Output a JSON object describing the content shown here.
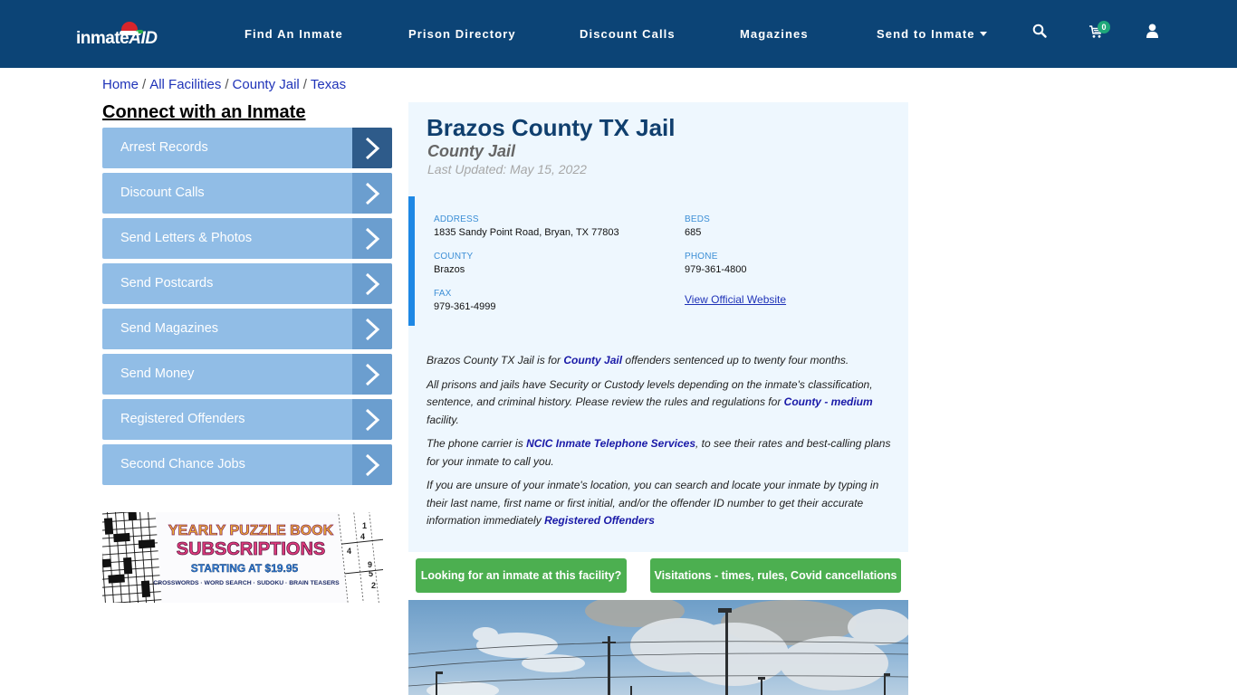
{
  "nav": {
    "logo_text_main": "inmate",
    "logo_text_accent": "AID",
    "links": [
      {
        "label": "Find An Inmate"
      },
      {
        "label": "Prison Directory"
      },
      {
        "label": "Discount Calls"
      },
      {
        "label": "Magazines"
      },
      {
        "label": "Send to Inmate"
      }
    ],
    "cart_count": "0",
    "icons": [
      "search-icon",
      "cart-icon",
      "user-icon"
    ]
  },
  "breadcrumb": [
    {
      "label": "Home"
    },
    {
      "label": "All Facilities"
    },
    {
      "label": "County Jail"
    },
    {
      "label": "Texas"
    }
  ],
  "breadcrumb_separator": "/",
  "sidebar": {
    "title": "Connect with an Inmate",
    "items": [
      {
        "label": "Arrest Records"
      },
      {
        "label": "Discount Calls"
      },
      {
        "label": "Send Letters & Photos"
      },
      {
        "label": "Send Postcards"
      },
      {
        "label": "Send Magazines"
      },
      {
        "label": "Send Money"
      },
      {
        "label": "Registered Offenders"
      },
      {
        "label": "Second Chance Jobs"
      }
    ],
    "ad": {
      "line1": "YEARLY PUZZLE BOOK",
      "line2": "SUBSCRIPTIONS",
      "line3": "STARTING AT $19.95",
      "line4": "CROSSWORDS · WORD SEARCH · SUDOKU · BRAIN TEASERS",
      "sudoku_digits": [
        "1",
        "4",
        "4",
        "9",
        "5",
        "2"
      ]
    }
  },
  "facility": {
    "title": "Brazos County TX Jail",
    "type": "County Jail",
    "last_updated": "Last Updated: May 15, 2022",
    "fields": {
      "address_label": "ADDRESS",
      "address": "1835 Sandy Point Road, Bryan, TX 77803",
      "beds_label": "BEDS",
      "beds": "685",
      "county_label": "COUNTY",
      "county": "Brazos",
      "phone_label": "PHONE",
      "phone": "979-361-4800",
      "fax_label": "FAX",
      "fax": "979-361-4999",
      "website_link": "View Official Website"
    },
    "description": {
      "p1_a": "Brazos County TX Jail is for ",
      "p1_link": "County Jail",
      "p1_b": " offenders sentenced up to twenty four months.",
      "p2_a": "All prisons and jails have Security or Custody levels depending on the inmate's classification, sentence, and criminal history. Please review the rules and regulations for ",
      "p2_link": "County - medium",
      "p2_b": " facility.",
      "p3_a": "The phone carrier is ",
      "p3_link": "NCIC Inmate Telephone Services",
      "p3_b": ", to see their rates and best-calling plans for your inmate to call you.",
      "p4_a": "If you are unsure of your inmate's location, you can search and locate your inmate by typing in their last name, first name or first initial, and/or the offender ID number to get their accurate information immediately ",
      "p4_link": "Registered Offenders"
    },
    "buttons": {
      "find_inmate": "Looking for an inmate at this facility?",
      "visitations": "Visitations - times, rules, Covid cancellations"
    }
  },
  "colors": {
    "nav_bg": "#0c4476",
    "sidebar_item": "#91bde6",
    "sidebar_arrow": "#6b9ecf",
    "sidebar_arrow_active": "#2e5b8a",
    "card_bg": "#eef7fe",
    "accent_blue": "#1e88e5",
    "button_green": "#4caf50",
    "link": "#1a1aa8"
  }
}
